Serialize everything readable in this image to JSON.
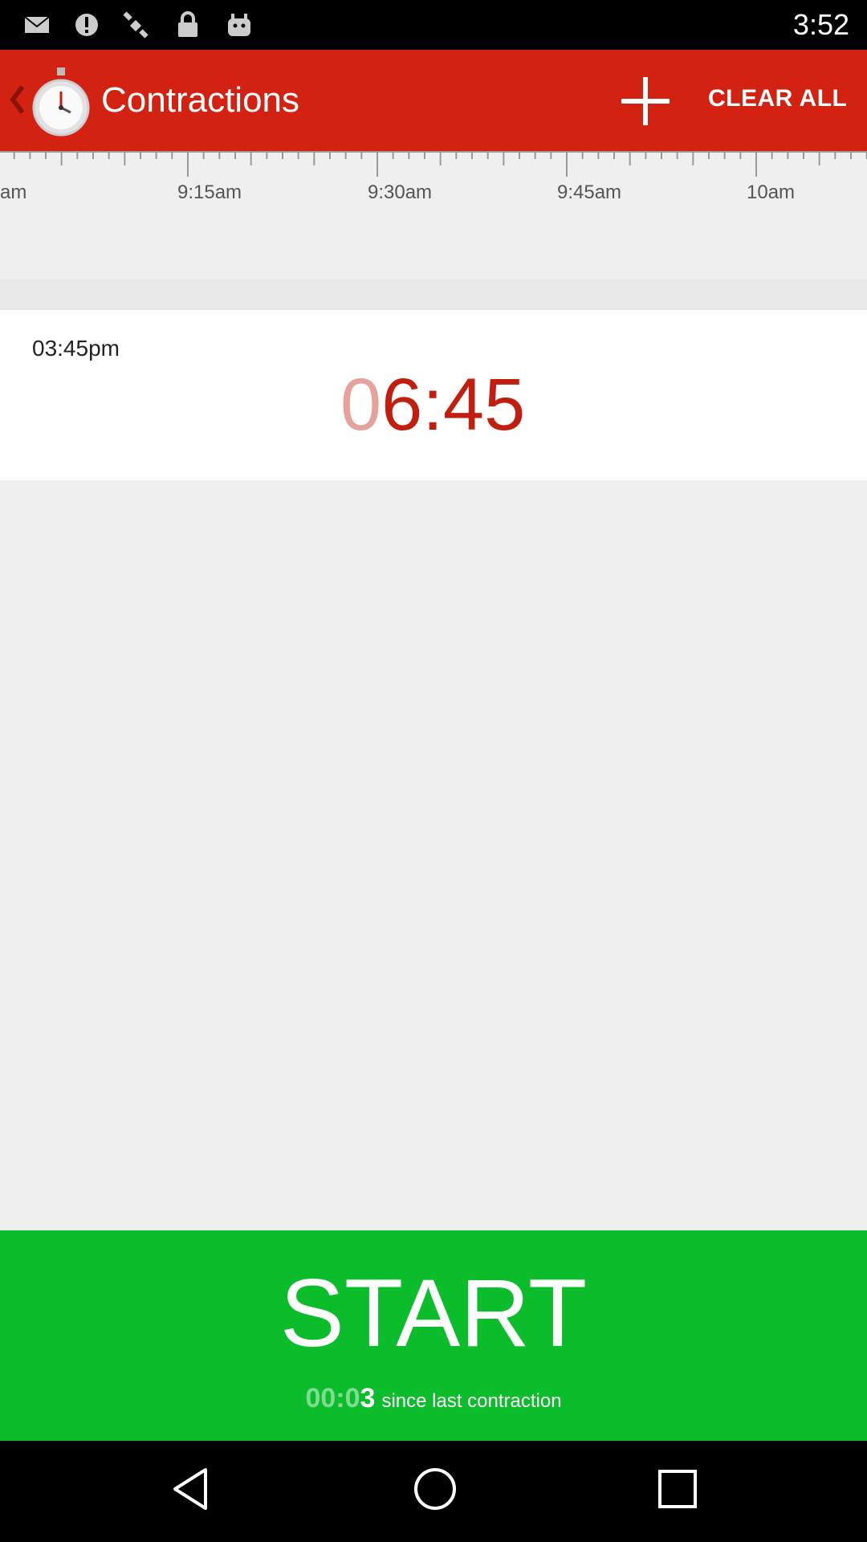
{
  "status_bar": {
    "time": "3:52",
    "icons": [
      "mail-icon",
      "alert-icon",
      "satellite-icon",
      "lock-icon",
      "android-icon"
    ]
  },
  "app_bar": {
    "title": "Contractions",
    "add_icon": "plus-icon",
    "clear_all_label": "CLEAR ALL"
  },
  "timeline": {
    "labels": [
      "am",
      "9:15am",
      "9:30am",
      "9:45am",
      "10am"
    ]
  },
  "entry": {
    "start_time": "03:45pm",
    "duration_lead": "0",
    "duration_rest": "6:45"
  },
  "start_panel": {
    "label": "START",
    "since_lead": "00:0",
    "since_digit": "3",
    "since_text": "since last contraction"
  },
  "colors": {
    "app_bar": "#d42212",
    "start_panel": "#0bbc2b",
    "duration": "#c21e0f"
  }
}
